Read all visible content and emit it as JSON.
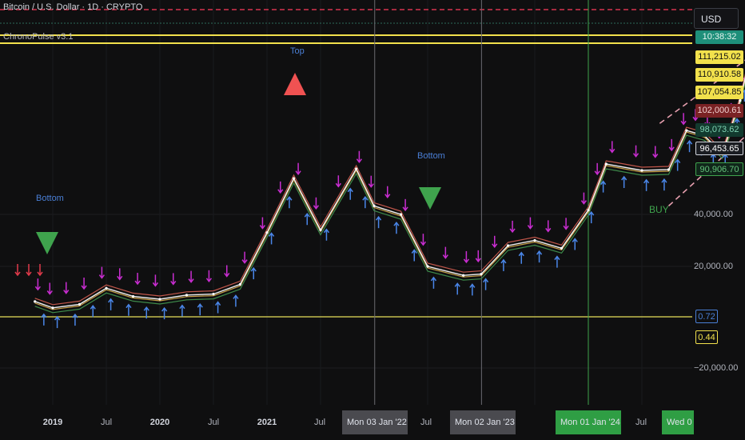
{
  "header": {
    "symbol_title": "Bitcoin / U.S. Dollar · 1D · CRYPTO",
    "indicator_name": "ChronoPulse v3.1",
    "currency_button": "USD"
  },
  "price_labels": [
    {
      "text": "10:38:32",
      "bg": "#1e8f7a",
      "fg": "#e6f5f0"
    },
    {
      "text": "111,215.02",
      "bg": "#f2e14c",
      "fg": "#111111"
    },
    {
      "text": "110,910.58",
      "bg": "#f2e14c",
      "fg": "#111111"
    },
    {
      "text": "107,054.85",
      "bg": "#f2e14c",
      "fg": "#111111"
    },
    {
      "text": "102,000.61",
      "bg": "#7a2224",
      "fg": "#f0d0d0"
    },
    {
      "text": "98,073.62",
      "bg": "#123a2e",
      "fg": "#7fd3b3"
    },
    {
      "text": "96,453.65",
      "bg": "#1b1d22",
      "fg": "#ffffff"
    },
    {
      "text": "90,906.70",
      "bg": "#10261a",
      "fg": "#63c27a"
    }
  ],
  "y_axis": {
    "ticks": [
      "40,000.00",
      "20,000.00",
      "−20,000.00"
    ],
    "oscillator_labels": [
      {
        "text": "0.72",
        "color": "#4a7fd6"
      },
      {
        "text": "0.44",
        "color": "#f2e14c"
      }
    ]
  },
  "x_axis": {
    "ticks": [
      {
        "text": "2019",
        "bold": true
      },
      {
        "text": "Jul",
        "bold": false
      },
      {
        "text": "2020",
        "bold": true
      },
      {
        "text": "Jul",
        "bold": false
      },
      {
        "text": "2021",
        "bold": true
      },
      {
        "text": "Jul",
        "bold": false
      },
      {
        "text": "Jul",
        "bold": false
      },
      {
        "text": "Jul",
        "bold": false
      }
    ],
    "highlight_labels": [
      {
        "text": "Mon 03 Jan '22",
        "bg": "#4a4a4f"
      },
      {
        "text": "Mon 02 Jan '23",
        "bg": "#4a4a4f"
      },
      {
        "text": "Mon 01 Jan '24",
        "bg": "#2f9e44"
      },
      {
        "text": "Wed 0",
        "bg": "#2f9e44"
      }
    ]
  },
  "annotations": [
    {
      "text": "Top",
      "color": "#4a7fd6"
    },
    {
      "text": "Bottom",
      "color": "#4a7fd6"
    },
    {
      "text": "Bottom",
      "color": "#4a7fd6"
    },
    {
      "text": "BUY",
      "color": "#3fa34d"
    }
  ],
  "chart_data": {
    "type": "line",
    "title": "Bitcoin / U.S. Dollar · 1D · CRYPTO",
    "xlabel": "",
    "ylabel": "",
    "x": [
      "2018-11",
      "2019-01",
      "2019-04",
      "2019-07",
      "2019-10",
      "2020-01",
      "2020-04",
      "2020-07",
      "2020-10",
      "2021-01",
      "2021-04",
      "2021-07",
      "2021-11",
      "2022-01",
      "2022-04",
      "2022-07",
      "2022-11",
      "2023-01",
      "2023-04",
      "2023-07",
      "2023-10",
      "2024-01",
      "2024-03",
      "2024-07",
      "2024-10",
      "2024-12",
      "2025-02",
      "2025-04",
      "2025-06",
      "2025-07"
    ],
    "series": [
      {
        "name": "",
        "color": "#f2f2f2",
        "values": [
          6300,
          3800,
          5200,
          11500,
          8300,
          7200,
          8800,
          9200,
          13000,
          33000,
          57000,
          34000,
          64000,
          44000,
          40000,
          20000,
          16500,
          17000,
          28000,
          30000,
          27000,
          42000,
          70000,
          62000,
          63000,
          97000,
          95000,
          83000,
          104000,
          110900
        ]
      }
    ],
    "ylim": [
      -30000,
      120000
    ],
    "y_ticks": [
      -20000,
      20000,
      40000
    ],
    "horizontal_levels": [
      111215.02,
      110910.58,
      107054.85,
      102000.61,
      98073.62,
      96453.65,
      90906.7
    ],
    "oscillator_values": [
      0.72,
      0.44
    ],
    "vertical_markers": [
      "2022-01-03",
      "2023-01-02",
      "2024-01-01",
      "2025-07-09"
    ],
    "signals": [
      {
        "label": "Top",
        "x": "2021-04",
        "direction": "down"
      },
      {
        "label": "Bottom",
        "x": "2019-01",
        "direction": "up"
      },
      {
        "label": "Bottom",
        "x": "2022-07",
        "direction": "up"
      },
      {
        "label": "BUY",
        "x": "2024-10",
        "direction": "up"
      }
    ],
    "grid": true,
    "legend": "none"
  }
}
